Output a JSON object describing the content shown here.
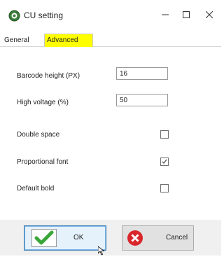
{
  "window": {
    "title": "CU setting",
    "icon": "app-icon",
    "controls": {
      "minimize": "minimize-icon",
      "maximize": "maximize-icon",
      "close": "close-icon"
    }
  },
  "tabs": [
    {
      "label": "General",
      "active": false
    },
    {
      "label": "Advanced",
      "active": true,
      "highlight_color": "#ffff00"
    }
  ],
  "fields": {
    "barcode_height": {
      "label": "Barcode height (PX)",
      "value": "16"
    },
    "high_voltage": {
      "label": "High voltage (%)",
      "value": "50"
    },
    "double_space": {
      "label": "Double space",
      "checked": false
    },
    "proportional_font": {
      "label": "Proportional font",
      "checked": true
    },
    "default_bold": {
      "label": "Default bold",
      "checked": false
    }
  },
  "buttons": {
    "ok": {
      "label": "OK",
      "icon": "green-check-icon"
    },
    "cancel": {
      "label": "Cancel",
      "icon": "red-x-icon"
    }
  }
}
